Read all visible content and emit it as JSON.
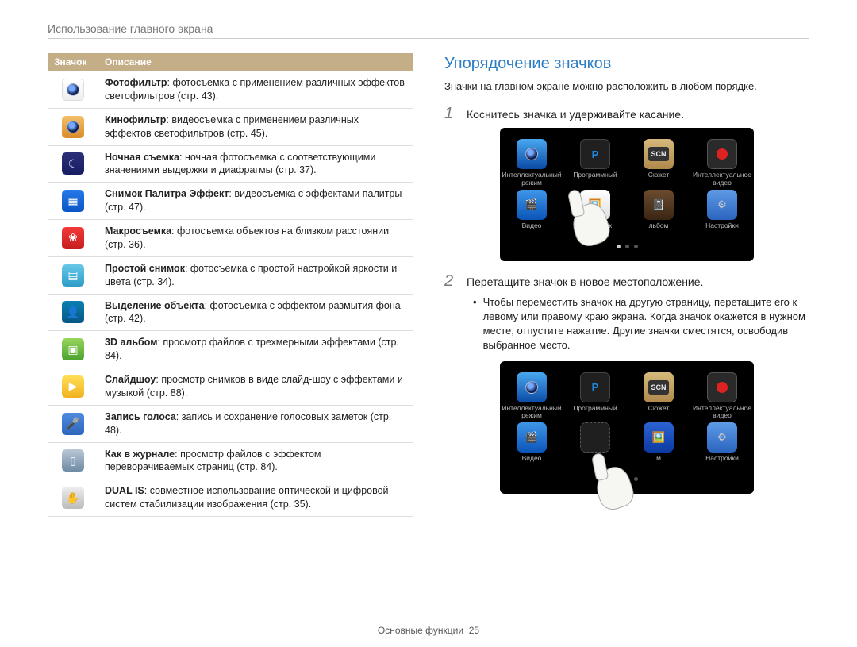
{
  "header": {
    "title": "Использование главного экрана"
  },
  "left": {
    "col_icon": "Значок",
    "col_desc": "Описание",
    "rows": [
      {
        "bold": "Фотофильтр",
        "body": ": фотосъемка с применением различных эффектов светофильтров (стр. 43)."
      },
      {
        "bold": "Кинофильтр",
        "body": ": видеосъемка с применением различных эффектов светофильтров (стр. 45)."
      },
      {
        "bold": "Ночная съемка",
        "body": ": ночная фотосъемка с соответствующими значениями выдержки и диафрагмы (стр. 37)."
      },
      {
        "bold": "Снимок Палитра Эффект",
        "body": ": видеосъемка с эффектами палитры (стр. 47)."
      },
      {
        "bold": "Макросъемка",
        "body": ": фотосъемка объектов на близком расстоянии (стр. 36)."
      },
      {
        "bold": "Простой снимок",
        "body": ": фотосъемка с простой настройкой яркости и цвета (стр. 34)."
      },
      {
        "bold": "Выделение объекта",
        "body": ": фотосъемка с эффектом размытия фона (стр. 42)."
      },
      {
        "bold": "3D альбом",
        "body": ": просмотр файлов с трехмерными эффектами (стр. 84)."
      },
      {
        "bold": "Слайдшоу",
        "body": ": просмотр снимков в виде слайд-шоу с эффектами и музыкой (стр. 88)."
      },
      {
        "bold": "Запись голоса",
        "body": ": запись и сохранение голосовых заметок (стр. 48)."
      },
      {
        "bold": "Как в журнале",
        "body": ": просмотр файлов с эффектом переворачиваемых страниц (стр. 84)."
      },
      {
        "bold": "DUAL IS",
        "body": ": совместное использование оптической и цифровой систем стабилизации изображения (стр. 35)."
      }
    ]
  },
  "right": {
    "title": "Упорядочение значков",
    "intro": "Значки на главном экране можно расположить в любом порядке.",
    "step1": "Коснитесь значка и удерживайте касание.",
    "step2": "Перетащите значок в новое местоположение.",
    "bullet": "Чтобы переместить значок на другую страницу, перетащите его к левому или правому краю экрана. Когда значок окажется в нужном месте, отпустите нажатие. Другие значки сместятся, освободив выбранное место.",
    "grid": {
      "smart": "Интеллектуальный режим",
      "program_letter": "P",
      "program": "Программный",
      "scene_letter": "SCN",
      "scene": "Сюжет",
      "smart_video": "Интеллектуальное видео",
      "video": "Видео",
      "editor": "Фоторедак",
      "album": "льбом",
      "settings": "Настройки",
      "album_cut": "м"
    }
  },
  "footer": {
    "label": "Основные функции",
    "page": "25"
  }
}
